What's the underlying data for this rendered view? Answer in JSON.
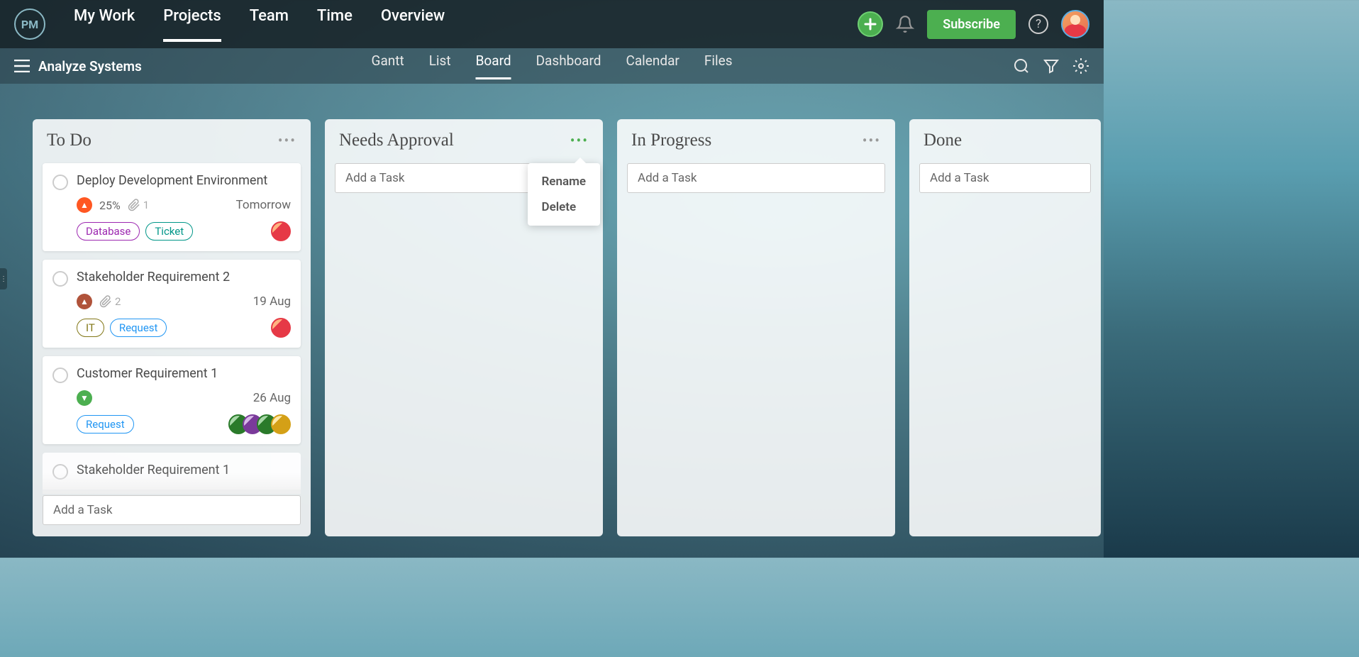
{
  "logo": "PM",
  "nav": {
    "items": [
      "My Work",
      "Projects",
      "Team",
      "Time",
      "Overview"
    ],
    "active": "Projects",
    "subscribe": "Subscribe"
  },
  "subbar": {
    "project": "Analyze Systems",
    "tabs": [
      "Gantt",
      "List",
      "Board",
      "Dashboard",
      "Calendar",
      "Files"
    ],
    "active": "Board"
  },
  "dropdown": {
    "rename": "Rename",
    "delete": "Delete"
  },
  "columns": [
    {
      "title": "To Do",
      "add_placeholder": "Add a Task",
      "cards": [
        {
          "title": "Deploy Development Environment",
          "percent": "25%",
          "attachments": "1",
          "due": "Tomorrow",
          "priority": "high",
          "tags": [
            {
              "text": "Database",
              "cls": "tag-purple"
            },
            {
              "text": "Ticket",
              "cls": "tag-green"
            }
          ],
          "avatars": [
            "av-red"
          ]
        },
        {
          "title": "Stakeholder Requirement 2",
          "percent": "",
          "attachments": "2",
          "due": "19 Aug",
          "priority": "med",
          "tags": [
            {
              "text": "IT",
              "cls": "tag-olive"
            },
            {
              "text": "Request",
              "cls": "tag-blue"
            }
          ],
          "avatars": [
            "av-red"
          ]
        },
        {
          "title": "Customer Requirement 1",
          "percent": "",
          "attachments": "",
          "due": "26 Aug",
          "priority": "low",
          "tags": [
            {
              "text": "Request",
              "cls": "tag-blue"
            }
          ],
          "avatars": [
            "av-green",
            "av-purple",
            "av-green",
            "av-yellow"
          ]
        }
      ],
      "partial_card": "Stakeholder Requirement 1"
    },
    {
      "title": "Needs Approval",
      "add_placeholder": "Add a Task",
      "menu_open": true
    },
    {
      "title": "In Progress",
      "add_placeholder": "Add a Task"
    },
    {
      "title": "Done",
      "add_placeholder": "Add a Task"
    }
  ]
}
